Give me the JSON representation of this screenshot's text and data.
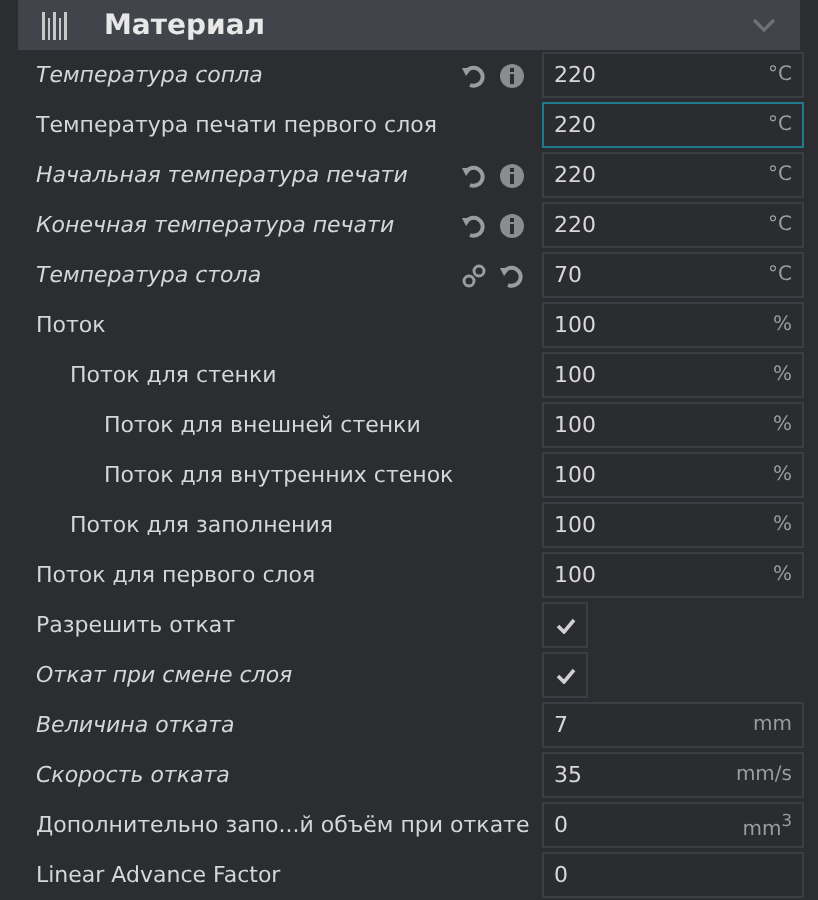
{
  "header": {
    "title": "Материал"
  },
  "rows": [
    {
      "label": "Температура сопла",
      "kind": "number",
      "italic": true,
      "focused": false,
      "value": "220",
      "unit": "°C",
      "icons": [
        {
          "kind": "reset"
        },
        {
          "kind": "info"
        }
      ]
    },
    {
      "label": "Температура печати первого слоя",
      "kind": "number",
      "italic": false,
      "focused": true,
      "value": "220",
      "unit": "°C"
    },
    {
      "label": "Начальная температура печати",
      "kind": "number",
      "italic": true,
      "focused": false,
      "value": "220",
      "unit": "°C",
      "icons": [
        {
          "kind": "reset"
        },
        {
          "kind": "info"
        }
      ]
    },
    {
      "label": "Конечная температура печати",
      "kind": "number",
      "italic": true,
      "focused": false,
      "value": "220",
      "unit": "°C",
      "icons": [
        {
          "kind": "reset"
        },
        {
          "kind": "info"
        }
      ]
    },
    {
      "label": "Температура стола",
      "kind": "number",
      "italic": true,
      "focused": false,
      "value": "70",
      "unit": "°C",
      "icons": [
        {
          "kind": "link"
        },
        {
          "kind": "reset"
        }
      ]
    },
    {
      "label": "Поток",
      "kind": "number",
      "italic": false,
      "focused": false,
      "value": "100",
      "unit": "%",
      "children": [
        {
          "label": "Поток для стенки",
          "kind": "number",
          "italic": false,
          "focused": false,
          "value": "100",
          "unit": "%",
          "children": [
            {
              "label": "Поток для внешней стенки",
              "kind": "number",
              "italic": false,
              "focused": false,
              "value": "100",
              "unit": "%"
            },
            {
              "label": "Поток для внутренних стенок",
              "kind": "number",
              "italic": false,
              "focused": false,
              "value": "100",
              "unit": "%"
            }
          ]
        },
        {
          "label": "Поток для заполнения",
          "kind": "number",
          "italic": false,
          "focused": false,
          "value": "100",
          "unit": "%"
        }
      ]
    },
    {
      "label": "Поток для первого слоя",
      "kind": "number",
      "italic": false,
      "focused": false,
      "value": "100",
      "unit": "%"
    },
    {
      "label": "Разрешить откат",
      "kind": "checkbox",
      "italic": false,
      "checked": true
    },
    {
      "label": "Откат при смене слоя",
      "kind": "checkbox",
      "italic": true,
      "checked": true
    },
    {
      "label": "Величина отката",
      "kind": "number",
      "italic": true,
      "focused": false,
      "value": "7",
      "unit": "mm"
    },
    {
      "label": "Скорость отката",
      "kind": "number",
      "italic": true,
      "focused": false,
      "value": "35",
      "unit": "mm/s"
    },
    {
      "label": "Дополнительно запо...й объём при откате",
      "kind": "number",
      "italic": false,
      "focused": false,
      "value": "0",
      "unit": "mm$^{3}$"
    },
    {
      "label": "Linear Advance Factor",
      "kind": "number",
      "italic": false,
      "focused": false,
      "value": "0"
    }
  ]
}
